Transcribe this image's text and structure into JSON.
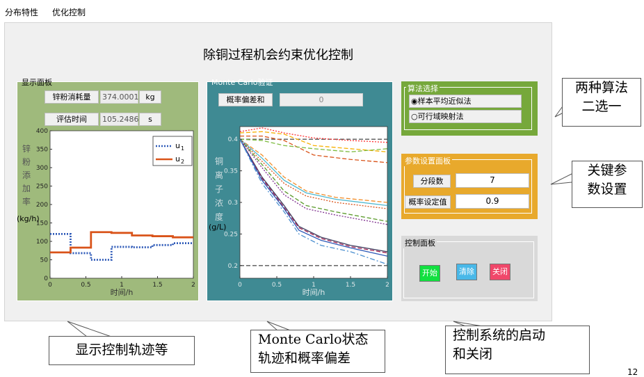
{
  "menu": [
    "分布特性",
    "优化控制"
  ],
  "app_title": "除铜过程机会约束优化控制",
  "display_panel": {
    "legend": "显示面板",
    "zinc_label": "锌粉消耗量",
    "zinc_value": "374.0001",
    "zinc_unit": "kg",
    "time_label": "评估时间",
    "time_value": "105.2486",
    "time_unit": "s",
    "ylabel": "锌粉添加率(kg/h)",
    "ylabel_chars": [
      "锌",
      "粉",
      "添",
      "加",
      "率"
    ],
    "ylabel_unit": "(kg/h)",
    "xlabel": "时间/h",
    "legend_u1": "u",
    "legend_u1_sub": "1",
    "legend_u2": "u",
    "legend_u2_sub": "2",
    "colors": {
      "bg": "#9fba7c",
      "u1": "#2e5ab8",
      "u2": "#d95319"
    }
  },
  "mc_panel": {
    "legend": "Monte Carlo验证",
    "prob_label": "概率偏差和",
    "prob_value": "0",
    "ylabel_chars": [
      "铜",
      "离",
      "子",
      "浓",
      "度"
    ],
    "ylabel_unit": "(g/L)",
    "xlabel": "时间/h",
    "colors": {
      "bg": "#3f8a93"
    }
  },
  "algo_panel": {
    "legend": "算法选择",
    "options": [
      "样本平均近似法",
      "可行域映射法"
    ],
    "selected": 0,
    "colors": {
      "bg": "#76a83b"
    }
  },
  "param_panel": {
    "legend": "参数设置面板",
    "segments_label": "分段数",
    "segments_value": "7",
    "prob_label": "概率设定值",
    "prob_value": "0.9",
    "colors": {
      "bg": "#e8a92c"
    }
  },
  "control_panel": {
    "legend": "控制面板",
    "start": "开始",
    "clear": "清除",
    "close": "关闭",
    "colors": {
      "start": "#12e040",
      "clear": "#49b8e8",
      "close": "#f0476a"
    }
  },
  "callouts": {
    "algo": [
      "两种算法",
      "二选一"
    ],
    "params": [
      "关键参",
      "数设置"
    ],
    "display": "显示控制轨迹等",
    "mc": [
      "Monte Carlo状态",
      "轨迹和概率偏差"
    ],
    "control": [
      "控制系统的启动",
      "和关闭"
    ]
  },
  "page_number": "12",
  "chart_data": [
    {
      "type": "line",
      "title": "",
      "xlabel": "时间/h",
      "ylabel": "锌粉添加率(kg/h)",
      "xlim": [
        0,
        2
      ],
      "ylim": [
        0,
        400
      ],
      "xticks": [
        "0",
        "0.5",
        "1",
        "1.5",
        "2"
      ],
      "yticks": [
        "0",
        "50",
        "100",
        "150",
        "200",
        "250",
        "300",
        "350",
        "400"
      ],
      "legend_position": "top-right",
      "series": [
        {
          "name": "u1",
          "style": "dotted",
          "x": [
            0,
            0.286,
            0.286,
            0.571,
            0.571,
            0.857,
            0.857,
            1.143,
            1.143,
            1.429,
            1.429,
            1.714,
            1.714,
            2.0
          ],
          "values": [
            120,
            120,
            68,
            68,
            50,
            50,
            85,
            85,
            84,
            84,
            90,
            90,
            95,
            95
          ]
        },
        {
          "name": "u2",
          "style": "solid",
          "x": [
            0,
            0.286,
            0.286,
            0.571,
            0.571,
            0.857,
            0.857,
            1.143,
            1.143,
            1.429,
            1.429,
            1.714,
            1.714,
            2.0
          ],
          "values": [
            70,
            70,
            83,
            83,
            125,
            125,
            123,
            123,
            116,
            116,
            114,
            114,
            111,
            111
          ]
        }
      ]
    },
    {
      "type": "line",
      "title": "",
      "xlabel": "时间/h",
      "ylabel": "铜离子浓度(g/L)",
      "xlim": [
        0,
        2
      ],
      "ylim": [
        0.18,
        0.42
      ],
      "xticks": [
        "0",
        "0.5",
        "1",
        "1.5",
        "2"
      ],
      "yticks": [
        "0.2",
        "0.25",
        "0.3",
        "0.35",
        "0.4"
      ],
      "series": [
        {
          "style": "dashed",
          "color": "#555555",
          "x": [
            0,
            2
          ],
          "values": [
            0.4,
            0.4
          ]
        },
        {
          "style": "dashed",
          "color": "#555555",
          "x": [
            0,
            2
          ],
          "values": [
            0.2,
            0.2
          ]
        },
        {
          "style": "dashed",
          "color": "#f7b000",
          "x": [
            0,
            0.3,
            0.6,
            1,
            1.5,
            2
          ],
          "values": [
            0.41,
            0.412,
            0.408,
            0.39,
            0.385,
            0.38
          ]
        },
        {
          "style": "dashed",
          "color": "#d95319",
          "x": [
            0,
            0.3,
            0.6,
            1,
            1.5,
            2
          ],
          "values": [
            0.405,
            0.405,
            0.398,
            0.375,
            0.368,
            0.363
          ]
        },
        {
          "style": "dotted",
          "color": "#ff3030",
          "x": [
            0,
            0.3,
            0.6,
            1,
            1.5,
            2
          ],
          "values": [
            0.412,
            0.418,
            0.41,
            0.402,
            0.398,
            0.395
          ]
        },
        {
          "style": "dashed",
          "color": "#7dbb40",
          "x": [
            0,
            0.3,
            0.6,
            1,
            1.5,
            2
          ],
          "values": [
            0.4,
            0.398,
            0.39,
            0.385,
            0.38,
            0.385
          ]
        },
        {
          "style": "dashed",
          "color": "#f28c28",
          "x": [
            0,
            0.3,
            0.6,
            0.9,
            1.3,
            2
          ],
          "values": [
            0.4,
            0.375,
            0.34,
            0.318,
            0.308,
            0.3
          ]
        },
        {
          "style": "solid",
          "color": "#4db8d0",
          "x": [
            0,
            0.3,
            0.6,
            0.9,
            1.3,
            2
          ],
          "values": [
            0.4,
            0.37,
            0.335,
            0.315,
            0.305,
            0.295
          ]
        },
        {
          "style": "dotted",
          "color": "#d95319",
          "x": [
            0,
            0.3,
            0.6,
            0.9,
            1.3,
            2
          ],
          "values": [
            0.4,
            0.365,
            0.33,
            0.31,
            0.3,
            0.29
          ]
        },
        {
          "style": "dashed",
          "color": "#5a9a2a",
          "x": [
            0,
            0.3,
            0.6,
            0.9,
            1.3,
            2
          ],
          "values": [
            0.4,
            0.36,
            0.318,
            0.295,
            0.285,
            0.27
          ]
        },
        {
          "style": "dotted",
          "color": "#7e2f8e",
          "x": [
            0,
            0.3,
            0.6,
            0.9,
            1.3,
            2
          ],
          "values": [
            0.4,
            0.355,
            0.312,
            0.29,
            0.28,
            0.265
          ]
        },
        {
          "style": "solid",
          "color": "#404060",
          "x": [
            0,
            0.3,
            0.6,
            0.8,
            1.1,
            1.5,
            2
          ],
          "values": [
            0.4,
            0.34,
            0.295,
            0.262,
            0.245,
            0.232,
            0.222
          ]
        },
        {
          "style": "dashed",
          "color": "#a02050",
          "x": [
            0,
            0.3,
            0.6,
            0.8,
            1.1,
            1.5,
            2
          ],
          "values": [
            0.4,
            0.338,
            0.292,
            0.26,
            0.243,
            0.23,
            0.22
          ]
        },
        {
          "style": "solid",
          "color": "#2e5ab8",
          "x": [
            0,
            0.3,
            0.6,
            0.8,
            1.1,
            1.5,
            2
          ],
          "values": [
            0.4,
            0.335,
            0.29,
            0.256,
            0.24,
            0.228,
            0.215
          ]
        },
        {
          "style": "dashdot",
          "color": "#4a8fd0",
          "x": [
            0,
            0.3,
            0.6,
            0.8,
            1.1,
            1.5,
            2
          ],
          "values": [
            0.4,
            0.33,
            0.285,
            0.25,
            0.232,
            0.222,
            0.202
          ]
        }
      ]
    }
  ]
}
